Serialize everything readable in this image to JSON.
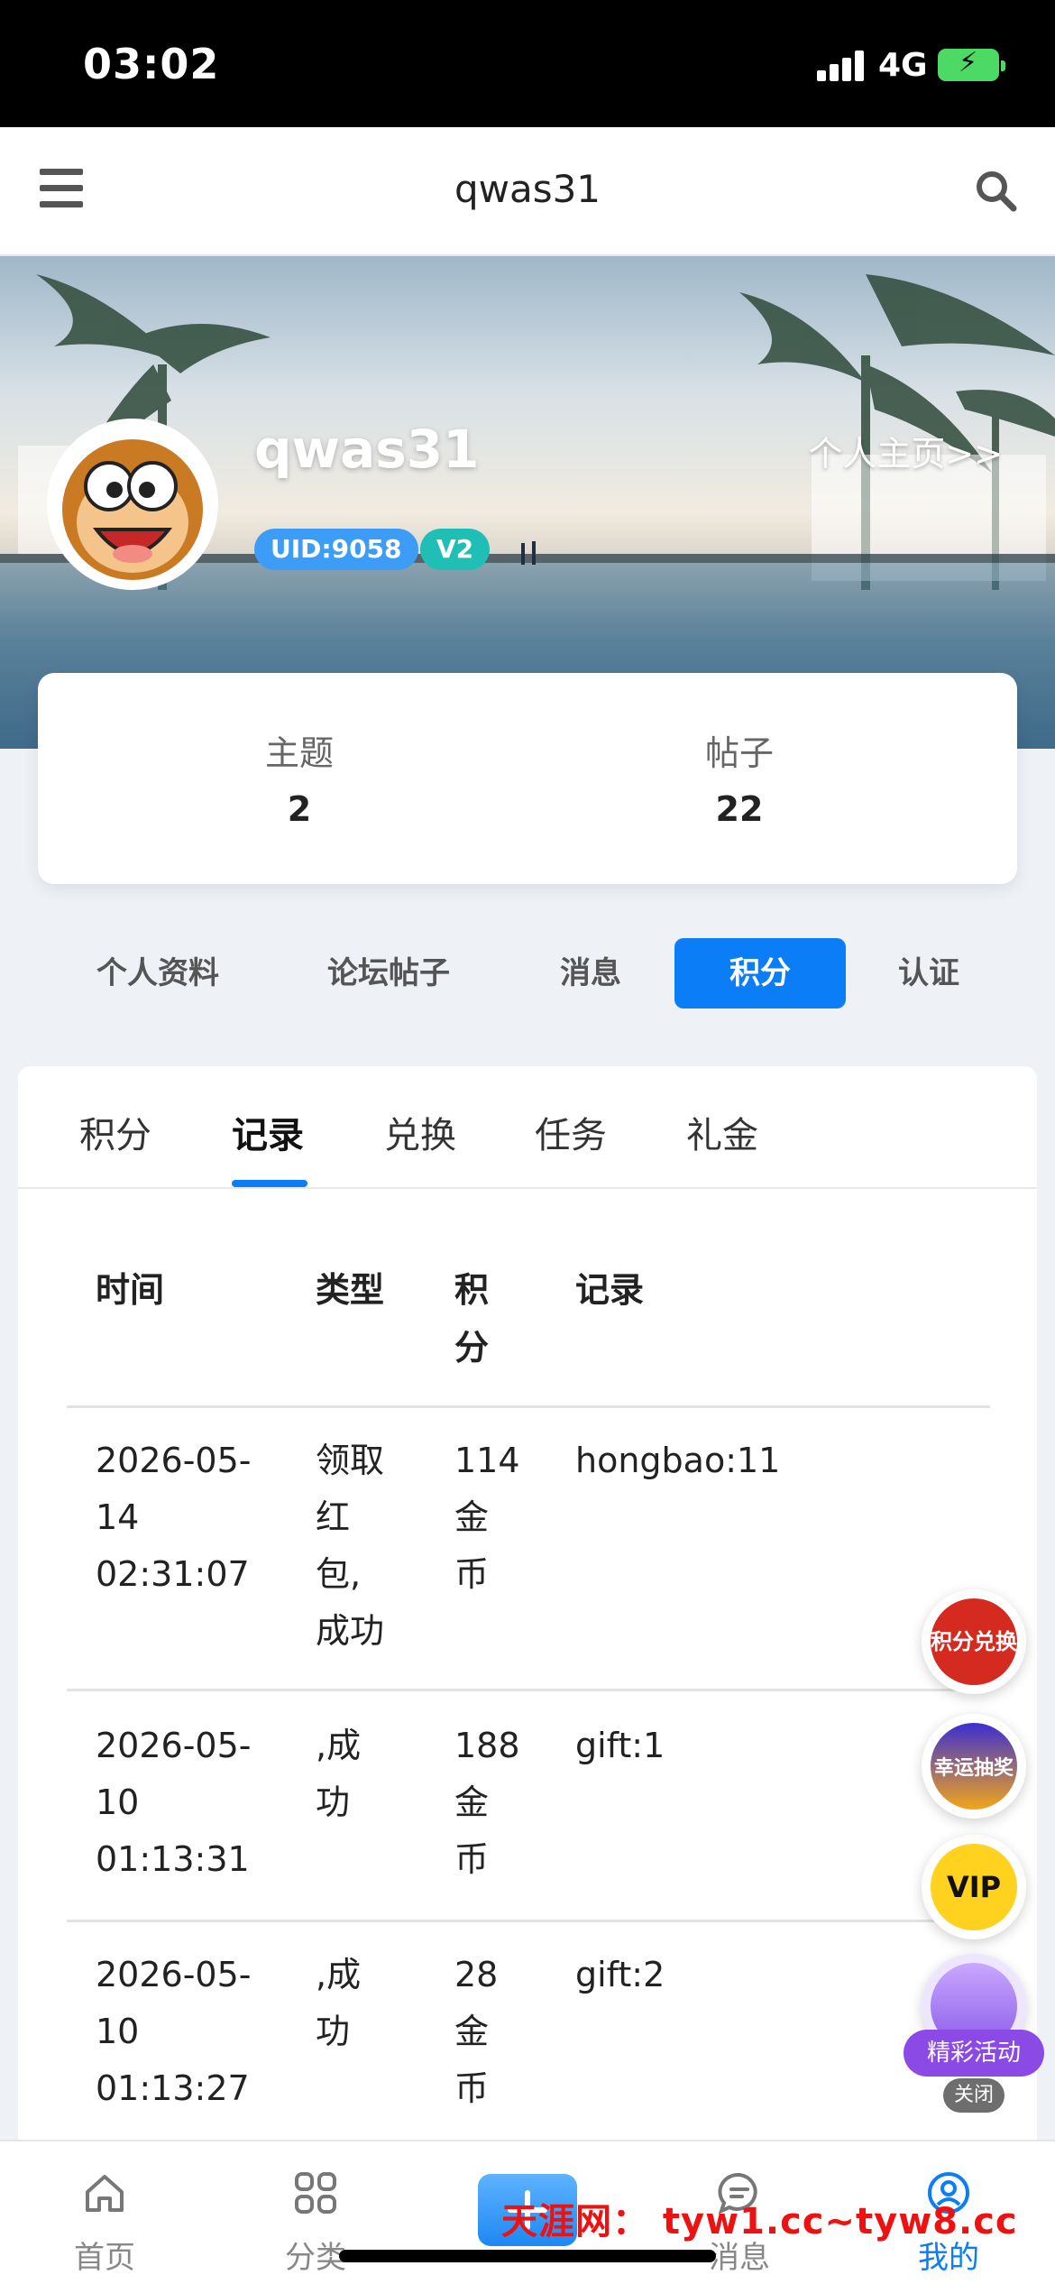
{
  "status_bar": {
    "time": "03:02",
    "network": "4G"
  },
  "nav": {
    "title": "qwas31"
  },
  "profile": {
    "username": "qwas31",
    "homepage_link": "个人主页>>",
    "uid": "UID:9058",
    "level": "V2"
  },
  "stats": [
    {
      "label": "主题",
      "value": "2"
    },
    {
      "label": "帖子",
      "value": "22"
    }
  ],
  "main_tabs": [
    "个人资料",
    "论坛帖子",
    "消息",
    "积分",
    "认证"
  ],
  "main_tabs_active": "积分",
  "sub_tabs": [
    "积分",
    "记录",
    "兑换",
    "任务",
    "礼金"
  ],
  "sub_tabs_active": "记录",
  "table": {
    "headers": [
      "时间",
      "类型",
      "积分",
      "记录"
    ],
    "rows": [
      {
        "time": [
          "2026-05-",
          "14",
          "02:31:07"
        ],
        "type": [
          "领取",
          "红",
          "包,",
          "成功"
        ],
        "points": [
          "114",
          "金",
          "币"
        ],
        "record": "hongbao:11"
      },
      {
        "time": [
          "2026-05-",
          "10",
          "01:13:31"
        ],
        "type": [
          ",成",
          "功"
        ],
        "points": [
          "188",
          "金",
          "币"
        ],
        "record": "gift:1"
      },
      {
        "time": [
          "2026-05-",
          "10",
          "01:13:27"
        ],
        "type": [
          ",成",
          "功"
        ],
        "points": [
          "28",
          "金",
          "币"
        ],
        "record": "gift:2"
      }
    ]
  },
  "floating": {
    "points_exchange": "积分兑换",
    "lucky_draw": "幸运抽奖",
    "vip": "VIP",
    "activity": "精彩活动",
    "close": "关闭"
  },
  "bottom_nav": [
    {
      "label": "首页",
      "icon": "home-icon"
    },
    {
      "label": "分类",
      "icon": "grid-icon"
    },
    {
      "label": "消息",
      "icon": "chat-icon"
    },
    {
      "label": "我的",
      "icon": "user-icon"
    }
  ],
  "watermark": "天涯网： tyw1.cc~tyw8.cc",
  "colors": {
    "accent": "#0a7df7",
    "uid_badge": "#3d9cf5",
    "level_badge": "#1fbfb6"
  }
}
